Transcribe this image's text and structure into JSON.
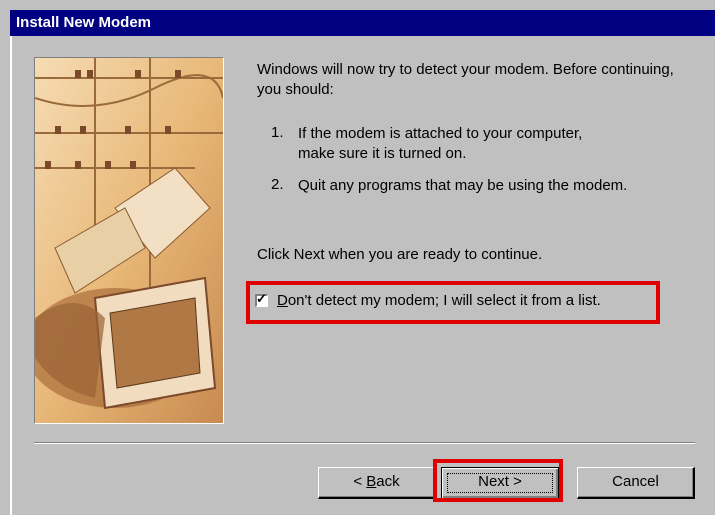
{
  "window": {
    "title": "Install New Modem"
  },
  "content": {
    "intro": "Windows will now try to detect your modem.  Before continuing, you should:",
    "steps": [
      {
        "num": "1.",
        "text": "If the modem is attached to your computer, make sure it is turned on."
      },
      {
        "num": "2.",
        "text": "Quit any programs that may be using the modem."
      }
    ],
    "click_next": "Click Next when you are ready to continue.",
    "checkbox": {
      "checked": true,
      "mnemonic": "D",
      "label_rest": "on't detect my modem; I will select it from a list."
    }
  },
  "buttons": {
    "back_prefix": "< ",
    "back_mnemonic": "B",
    "back_rest": "ack",
    "next": "Next >",
    "cancel": "Cancel"
  },
  "colors": {
    "title_bar": "#000080",
    "dialog": "#c0c0c0",
    "highlight": "#e00000"
  }
}
